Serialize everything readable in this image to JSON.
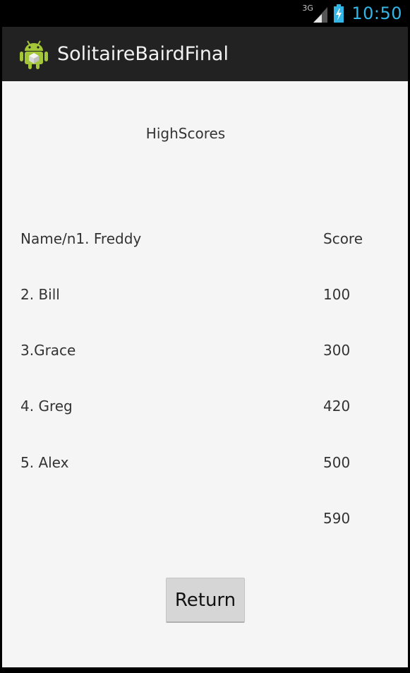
{
  "status_bar": {
    "network_label": "3G",
    "time": "10:50"
  },
  "action_bar": {
    "app_title": "SolitaireBairdFinal",
    "app_icon": "android-robot-icon"
  },
  "content": {
    "heading": "HighScores",
    "names": [
      "Name/n1. Freddy",
      "2. Bill",
      "3.Grace",
      "4. Greg",
      "5. Alex"
    ],
    "scores": [
      "Score",
      "100",
      "300",
      "420",
      "500",
      "590"
    ],
    "return_label": "Return"
  },
  "colors": {
    "status_bar_bg": "#000000",
    "action_bar_bg": "#222222",
    "content_bg": "#f5f5f5",
    "clock_color": "#33b5e5",
    "android_green": "#a4c639",
    "button_bg": "#d6d6d6"
  }
}
